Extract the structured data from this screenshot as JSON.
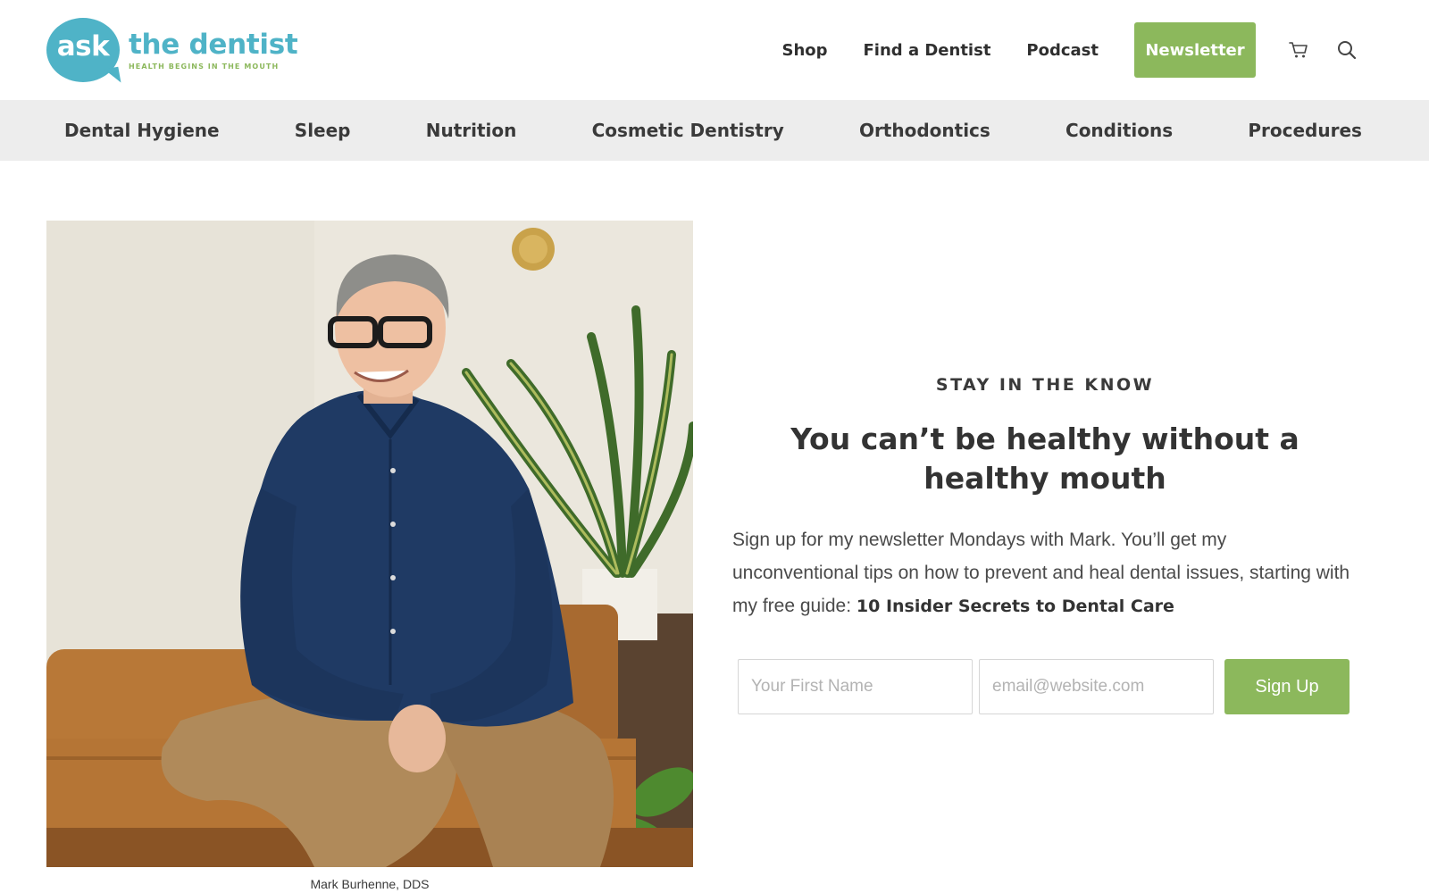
{
  "logo": {
    "bubble_text": "ask",
    "main_text": "the dentist",
    "tagline": "HEALTH BEGINS IN THE MOUTH",
    "brand_color": "#4fb3c7",
    "accent_color": "#8cb85c"
  },
  "topnav": {
    "links": [
      "Shop",
      "Find a Dentist",
      "Podcast"
    ],
    "newsletter_label": "Newsletter",
    "icons": [
      "cart-icon",
      "search-icon"
    ]
  },
  "categories": [
    "Dental Hygiene",
    "Sleep",
    "Nutrition",
    "Cosmetic Dentistry",
    "Orthodontics",
    "Conditions",
    "Procedures"
  ],
  "hero": {
    "caption": "Mark Burhenne, DDS"
  },
  "signup": {
    "eyebrow": "STAY IN THE KNOW",
    "headline": "You can’t be healthy without a healthy mouth",
    "body": "Sign up for my newsletter Mondays with Mark. You’ll get my unconventional tips on how to prevent and heal dental issues, starting with my free guide: ",
    "body_bold": "10 Insider Secrets to Dental Care",
    "first_name_placeholder": "Your First Name",
    "email_placeholder": "email@website.com",
    "button_label": "Sign Up"
  }
}
